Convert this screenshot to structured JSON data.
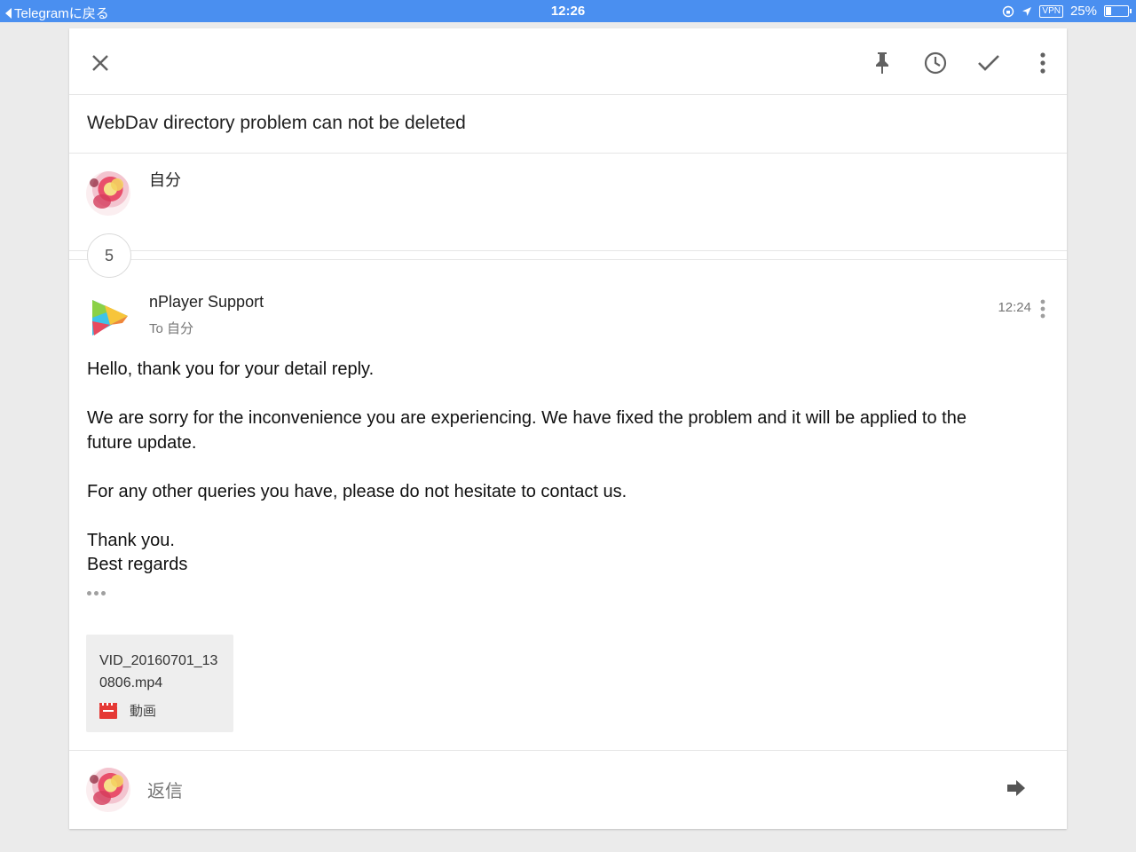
{
  "status_bar": {
    "back_label": "Telegramに戻る",
    "time": "12:26",
    "vpn": "VPN",
    "battery": "25%",
    "battery_level": 0.25
  },
  "toolbar": {
    "close_icon": "close-icon",
    "pin_icon": "pin-icon",
    "snooze_icon": "clock-icon",
    "done_icon": "check-icon",
    "more_icon": "more-vert-icon"
  },
  "subject": "WebDav directory problem can not be deleted",
  "thread": {
    "me_label": "自分",
    "collapsed_count": "5"
  },
  "message": {
    "sender": "nPlayer Support",
    "to": "To 自分",
    "time": "12:24",
    "body": [
      "Hello, thank you for your detail reply.",
      "We are sorry for the inconvenience you are experiencing. We have fixed the problem and it will be applied to the future update.",
      "For any other queries you have, please do not hesitate to contact us.",
      "Thank you.",
      "Best regards"
    ]
  },
  "attachment": {
    "name": "VID_20160701_130806.mp4",
    "type": "動画"
  },
  "reply": {
    "placeholder": "返信"
  },
  "colors": {
    "status_bar": "#4a8ff0",
    "attachment_icon": "#e53935",
    "icon_gray": "#616161"
  }
}
